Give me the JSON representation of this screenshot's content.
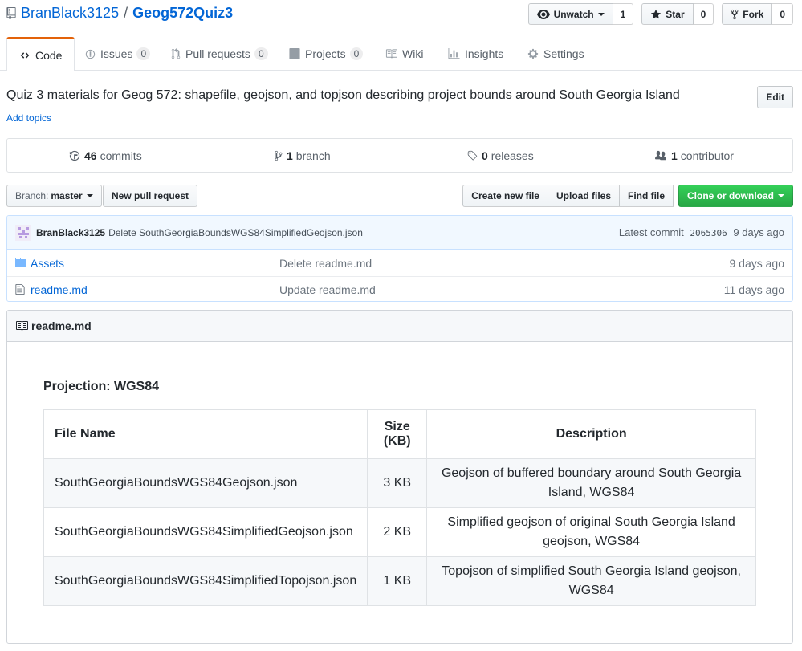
{
  "repo": {
    "owner": "BranBlack3125",
    "separator": "/",
    "name": "Geog572Quiz3"
  },
  "actions": {
    "watch": {
      "label": "Unwatch",
      "count": "1"
    },
    "star": {
      "label": "Star",
      "count": "0"
    },
    "fork": {
      "label": "Fork",
      "count": "0"
    }
  },
  "tabs": [
    {
      "label": "Code"
    },
    {
      "label": "Issues",
      "count": "0"
    },
    {
      "label": "Pull requests",
      "count": "0"
    },
    {
      "label": "Projects",
      "count": "0"
    },
    {
      "label": "Wiki"
    },
    {
      "label": "Insights"
    },
    {
      "label": "Settings"
    }
  ],
  "description": "Quiz 3 materials for Geog 572: shapefile, geojson, and topjson describing project bounds around South Georgia Island",
  "add_topics": "Add topics",
  "edit_label": "Edit",
  "numbers": {
    "commits": {
      "count": "46",
      "label": "commits"
    },
    "branches": {
      "count": "1",
      "label": "branch"
    },
    "releases": {
      "count": "0",
      "label": "releases"
    },
    "contributors": {
      "count": "1",
      "label": "contributor"
    }
  },
  "branch": {
    "label": "Branch:",
    "value": "master"
  },
  "new_pr": "New pull request",
  "file_actions": {
    "create": "Create new file",
    "upload": "Upload files",
    "find": "Find file",
    "clone": "Clone or download"
  },
  "latest_commit": {
    "author": "BranBlack3125",
    "message": "Delete SouthGeorgiaBoundsWGS84SimplifiedGeojson.json",
    "prefix": "Latest commit",
    "sha": "2065306",
    "age": "9 days ago"
  },
  "files": [
    {
      "type": "folder",
      "name": "Assets",
      "message": "Delete readme.md",
      "age": "9 days ago"
    },
    {
      "type": "file",
      "name": "readme.md",
      "message": "Update readme.md",
      "age": "11 days ago"
    }
  ],
  "readme": {
    "filename": "readme.md",
    "projection": "Projection: WGS84",
    "table": {
      "headers": [
        "File Name",
        "Size (KB)",
        "Description"
      ],
      "rows": [
        [
          "SouthGeorgiaBoundsWGS84Geojson.json",
          "3 KB",
          "Geojson of buffered boundary around South Georgia Island, WGS84"
        ],
        [
          "SouthGeorgiaBoundsWGS84SimplifiedGeojson.json",
          "2 KB",
          "Simplified geojson of original South Georgia Island geojson, WGS84"
        ],
        [
          "SouthGeorgiaBoundsWGS84SimplifiedTopojson.json",
          "1 KB",
          "Topojson of simplified South Georgia Island geojson, WGS84"
        ]
      ]
    }
  },
  "colors": {
    "link": "#0366d6",
    "tab_accent": "#e36209",
    "primary_button": "#28a745",
    "commit_bg": "#f1f8ff"
  }
}
